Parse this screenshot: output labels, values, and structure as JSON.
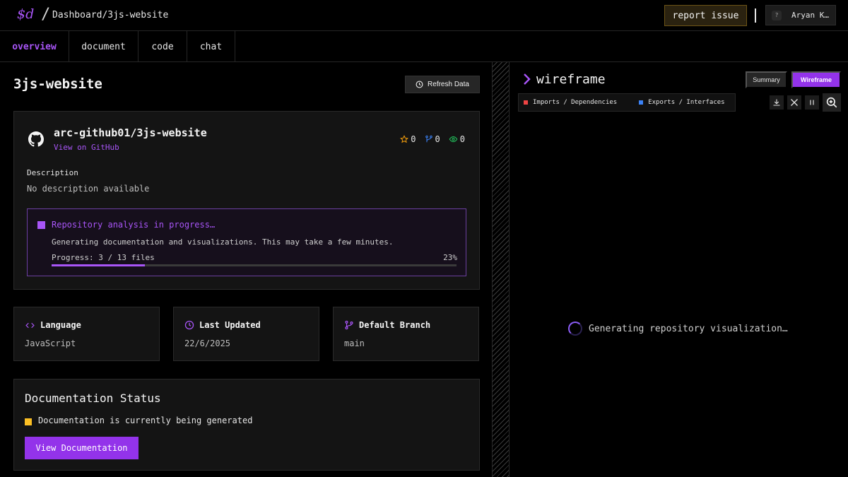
{
  "header": {
    "logo": "$d",
    "separator": "/",
    "breadcrumb": "Dashboard/3js-website",
    "report_label": "report issue",
    "user_initial": "?",
    "user_name": "Aryan K…"
  },
  "tabs": [
    {
      "label": "overview",
      "active": true
    },
    {
      "label": "document",
      "active": false
    },
    {
      "label": "code",
      "active": false
    },
    {
      "label": "chat",
      "active": false
    }
  ],
  "page": {
    "title": "3js-website",
    "refresh_label": "Refresh Data"
  },
  "repo": {
    "full_name": "arc-github01/3js-website",
    "github_link": "View on GitHub",
    "stars": "0",
    "forks": "0",
    "watchers": "0",
    "description_label": "Description",
    "description": "No description available"
  },
  "analysis": {
    "title": "Repository analysis in progress…",
    "subtitle": "Generating documentation and visualizations. This may take a few minutes.",
    "progress_text": "Progress: 3 / 13 files",
    "percent_text": "23%",
    "progress_fraction": 0.23
  },
  "info_cards": [
    {
      "title": "Language",
      "value": "JavaScript",
      "icon": "code-icon"
    },
    {
      "title": "Last Updated",
      "value": "22/6/2025",
      "icon": "clock-icon"
    },
    {
      "title": "Default Branch",
      "value": "main",
      "icon": "branch-icon"
    }
  ],
  "documentation": {
    "title": "Documentation Status",
    "status": "Documentation is currently being generated",
    "button_label": "View Documentation"
  },
  "wireframe": {
    "title": "wireframe",
    "summary_label": "Summary",
    "wireframe_label": "Wireframe",
    "legend_imports": "Imports / Dependencies",
    "legend_exports": "Exports / Interfaces",
    "loading_text": "Generating repository visualization…"
  },
  "colors": {
    "accent": "#a855f7",
    "imports": "#ef4444",
    "exports": "#3b82f6",
    "warning": "#fbbf24",
    "stars": "#f59e0b",
    "forks": "#3b82f6",
    "watchers": "#22c55e"
  }
}
